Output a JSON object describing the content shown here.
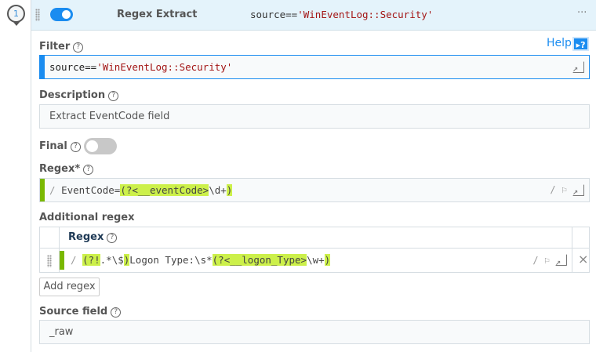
{
  "route": {
    "index": "1",
    "title": "Regex Extract",
    "filter_prefix": "source==",
    "filter_value": "'WinEventLog::Security'",
    "more": "···"
  },
  "help": {
    "label": "Help",
    "icon": "▸?"
  },
  "filter": {
    "label": "Filter",
    "prefix": "source==",
    "value": "'WinEventLog::Security'"
  },
  "description": {
    "label": "Description",
    "value": "Extract EventCode field"
  },
  "final": {
    "label": "Final",
    "enabled": false
  },
  "regex": {
    "label": "Regex*",
    "slash": "/",
    "parts": [
      "EventCode=",
      "(?<__eventCode>",
      "\\d+",
      ")"
    ],
    "flags": "/ ⚐"
  },
  "additional": {
    "label": "Additional regex",
    "column": "Regex",
    "rows": [
      {
        "slash": "/",
        "parts": [
          "(?!",
          ".*\\$",
          ")",
          "Logon Type:\\s*",
          "(?<__logon_Type>",
          "\\w+",
          ")"
        ],
        "flags": "/ ⚐",
        "remove": "×"
      }
    ],
    "add_label": "Add regex"
  },
  "source": {
    "label": "Source field",
    "value": "_raw"
  },
  "colors": {
    "accent": "#1a8cf0",
    "regex_bar": "#7ab800",
    "highlight": "#ccf04a",
    "header_bg": "#e4f3fb"
  }
}
